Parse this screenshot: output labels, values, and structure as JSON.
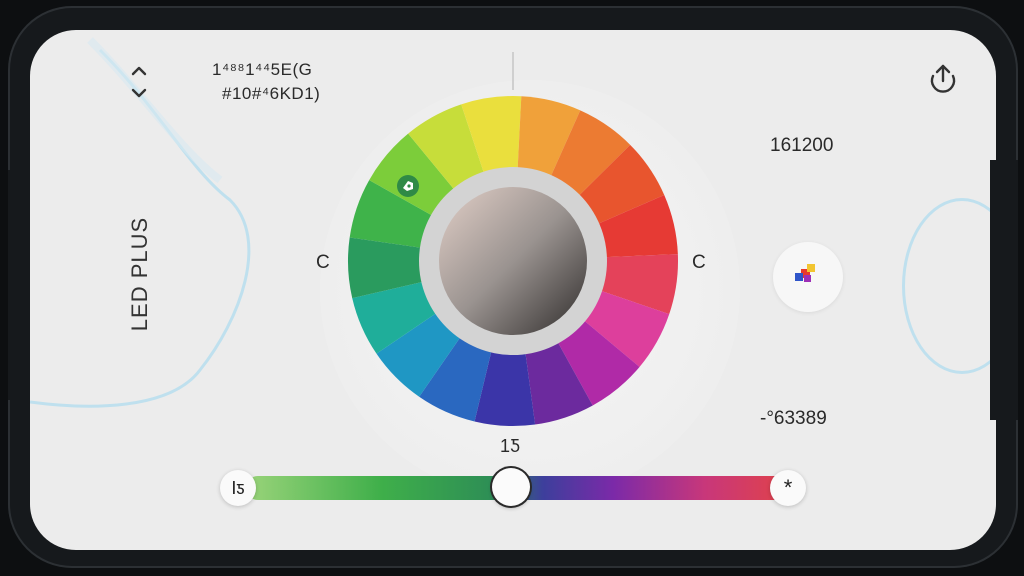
{
  "app": {
    "title": "LED PLUS"
  },
  "header": {
    "hex_line_1": "1⁴⁸⁸1⁴⁴5E(G",
    "hex_line_2": "#10#⁴6KD1)"
  },
  "wheel": {
    "left_label": "C",
    "right_label": "C",
    "segments": [
      "#3fb34a",
      "#7ccd3a",
      "#c7dd3a",
      "#eadf3d",
      "#f0a13a",
      "#ec7b32",
      "#e8552e",
      "#e63a34",
      "#e4425a",
      "#dd3f9c",
      "#b02aa7",
      "#6c2a9e",
      "#3b35a8",
      "#2a68c0",
      "#1f97c4",
      "#1fae9a",
      "#2a9b5e"
    ],
    "center_gradient": [
      "#d9c3bb",
      "#8f8a88",
      "#3b3736"
    ],
    "marker_icon": "tag-marker-icon"
  },
  "readouts": {
    "top_value": "161200",
    "bottom_value": "-°63389"
  },
  "slider": {
    "value_label": "1Ƽ",
    "left_button_label": "Iƽ",
    "right_button_label": "*",
    "value": 0.49
  },
  "icons": {
    "share": "share-icon",
    "chevrons": "chevron-up-down-icon",
    "palette": "palette-icon"
  },
  "colors": {
    "background": "#ececec",
    "accent": "#3fb34a"
  }
}
